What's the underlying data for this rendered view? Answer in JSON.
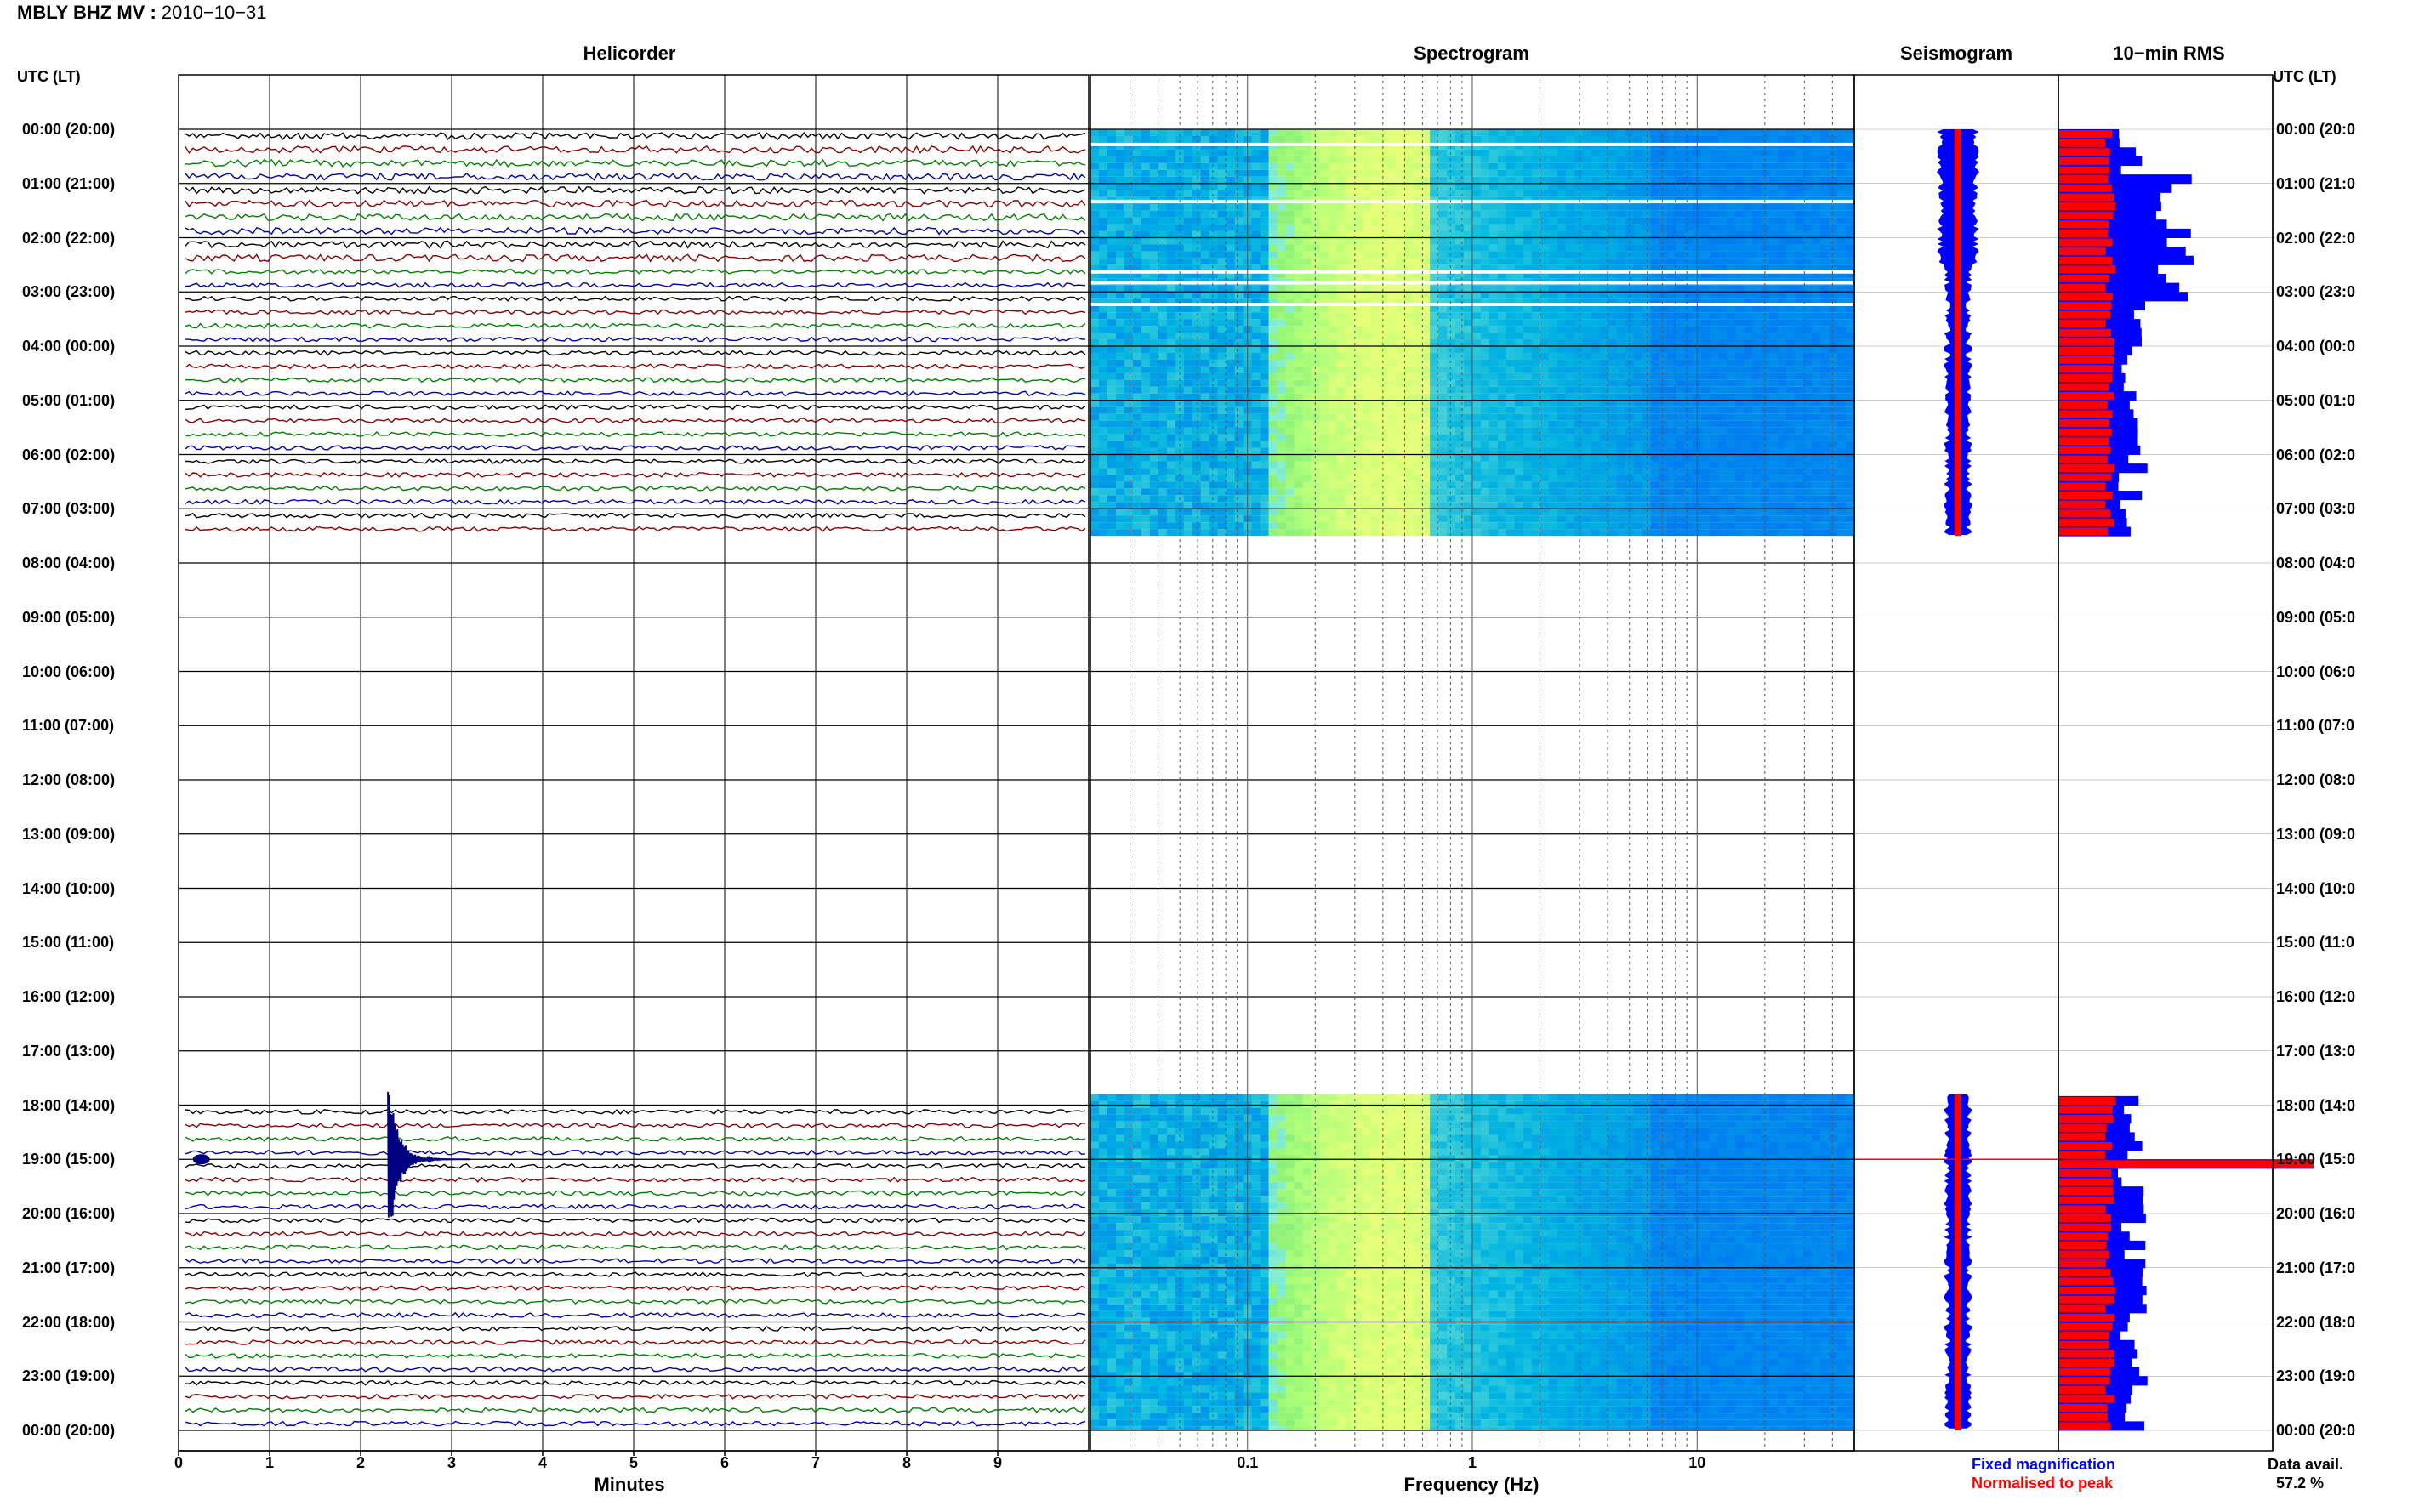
{
  "header": {
    "station": "MBLY BHZ MV :",
    "date": "2010−10−31"
  },
  "panels": {
    "helicorder": "Helicorder",
    "spectrogram": "Spectrogram",
    "seismogram": "Seismogram",
    "rms": "10−min RMS"
  },
  "axes": {
    "left_label": "UTC (LT)",
    "right_label": "UTC (LT)",
    "minutes_label": "Minutes",
    "frequency_label": "Frequency (Hz)",
    "minute_ticks": [
      "0",
      "1",
      "2",
      "3",
      "4",
      "5",
      "6",
      "7",
      "8",
      "9"
    ],
    "frequency_ticks": [
      "0.1",
      "1",
      "10"
    ],
    "hour_ticks": [
      "00:00 (20:00)",
      "01:00 (21:00)",
      "02:00 (22:00)",
      "03:00 (23:00)",
      "04:00 (00:00)",
      "05:00 (01:00)",
      "06:00 (02:00)",
      "07:00 (03:00)",
      "08:00 (04:00)",
      "09:00 (05:00)",
      "10:00 (06:00)",
      "11:00 (07:00)",
      "12:00 (08:00)",
      "13:00 (09:00)",
      "14:00 (10:00)",
      "15:00 (11:00)",
      "16:00 (12:00)",
      "17:00 (13:00)",
      "18:00 (14:00)",
      "19:00 (15:00)",
      "20:00 (16:00)",
      "21:00 (17:00)",
      "22:00 (18:00)",
      "23:00 (19:00)",
      "00:00 (20:00)"
    ],
    "right_hour_ticks": [
      "00:00 (20:0",
      "01:00 (21:0",
      "02:00 (22:0",
      "03:00 (23:0",
      "04:00 (00:0",
      "05:00 (01:0",
      "06:00 (02:0",
      "07:00 (03:0",
      "08:00 (04:0",
      "09:00 (05:0",
      "10:00 (06:0",
      "11:00 (07:0",
      "12:00 (08:0",
      "13:00 (09:0",
      "14:00 (10:0",
      "15:00 (11:0",
      "16:00 (12:0",
      "17:00 (13:0",
      "18:00 (14:0",
      "19:00 (15:0",
      "20:00 (16:0",
      "21:00 (17:0",
      "22:00 (18:0",
      "23:00 (19:0",
      "00:00 (20:0"
    ]
  },
  "legend": {
    "fixed": "Fixed magnification",
    "fixed_color": "#0000ff",
    "normalised": "Normalised to peak",
    "normalised_color": "#ff0000"
  },
  "availability": {
    "label": "Data avail.",
    "value": "57.2 %"
  },
  "chart_data": [
    {
      "type": "line",
      "panel": "helicorder",
      "xlabel": "Minutes",
      "xlim": [
        0,
        10
      ],
      "trace_colors": [
        "#000000",
        "#8b0000",
        "#008000",
        "#0000aa"
      ],
      "data_segments_utc_hours": [
        [
          0,
          7.5
        ],
        [
          17.8,
          24
        ]
      ],
      "event": {
        "utc_hour": 19,
        "minute": 2.3
      }
    },
    {
      "type": "heatmap",
      "panel": "spectrogram",
      "xlabel": "Frequency (Hz)",
      "x_scale": "log",
      "xlim": [
        0.02,
        50
      ],
      "data_segments_utc_hours": [
        [
          0,
          7.5
        ],
        [
          17.8,
          24
        ]
      ]
    },
    {
      "type": "area",
      "panel": "seismogram",
      "series": [
        {
          "name": "Fixed magnification",
          "color": "#0000ff"
        },
        {
          "name": "Normalised to peak",
          "color": "#ff0000"
        }
      ]
    },
    {
      "type": "bar",
      "panel": "rms",
      "series": [
        {
          "name": "Fixed magnification",
          "color": "#0000ff"
        },
        {
          "name": "Normalised to peak",
          "color": "#ff0000"
        }
      ],
      "peak_utc_hour": 19
    }
  ]
}
